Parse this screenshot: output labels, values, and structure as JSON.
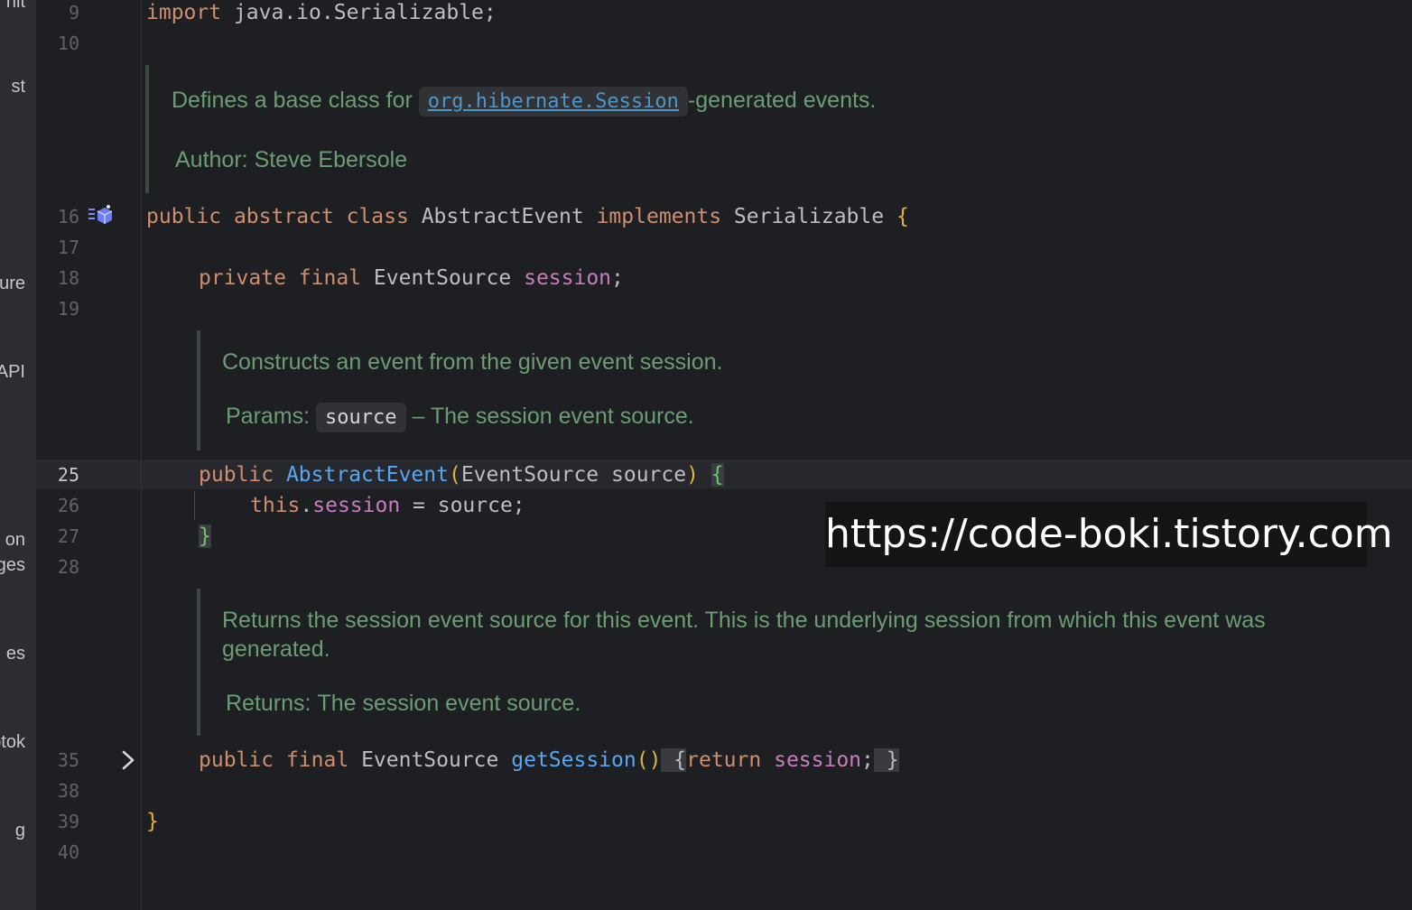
{
  "sidebar": {
    "items": [
      "nit",
      "st",
      "ure",
      "API",
      "on",
      "ges",
      "es",
      "otok",
      "g"
    ]
  },
  "gutter": {
    "line_numbers": [
      "9",
      "10",
      "16",
      "17",
      "18",
      "19",
      "25",
      "26",
      "27",
      "28",
      "35",
      "38",
      "39",
      "40"
    ],
    "current_line": "25",
    "icons": [
      "implementations-icon",
      "fold-chevron-icon"
    ]
  },
  "code": {
    "l9": {
      "kw": "import",
      "rest": " java.io.Serializable;"
    },
    "l16": {
      "kw1": "public",
      "kw2": "abstract",
      "kw3": "class",
      "name": "AbstractEvent",
      "kw4": "implements",
      "iface": "Serializable",
      "brace": "{"
    },
    "l18": {
      "kw1": "private",
      "kw2": "final",
      "type": "EventSource",
      "field": "session",
      "end": ";"
    },
    "l25": {
      "kw": "public",
      "fn": "AbstractEvent",
      "open": "(",
      "params": "EventSource source",
      "close": ")",
      "brace": "{"
    },
    "l26": {
      "kw": "this",
      "dot": ".",
      "field": "session",
      "rest": " = source;"
    },
    "l27": {
      "brace": "}"
    },
    "l35": {
      "kw1": "public",
      "kw2": "final",
      "type": "EventSource",
      "fn": "getSession",
      "parens": "()",
      "open": " {",
      "kw3": "return",
      "field": "session",
      "end": ";",
      "close": " }"
    },
    "l39": {
      "brace": "}"
    }
  },
  "docs": {
    "class_doc": {
      "text_before": "Defines a base class for ",
      "link": "org.hibernate.Session",
      "text_after": "-generated events.",
      "author_label": "Author:",
      "author_value": "Steve Ebersole"
    },
    "ctor_doc": {
      "text": "Constructs an event from the given event session.",
      "params_label": "Params:",
      "param_name": "source",
      "param_desc": " – The session event source."
    },
    "getter_doc": {
      "text": "Returns the session event source for this event. This is the underlying session from which this event was generated.",
      "returns_label": "Returns:",
      "returns_value": "The session event source."
    }
  },
  "watermark": "https://code-boki.tistory.com",
  "colors": {
    "background": "#1e1f22",
    "keyword": "#cf8e6d",
    "function": "#56a8f5",
    "field": "#c77dbb",
    "doc_text": "#6c9c74",
    "brace": "#e0b33a"
  }
}
